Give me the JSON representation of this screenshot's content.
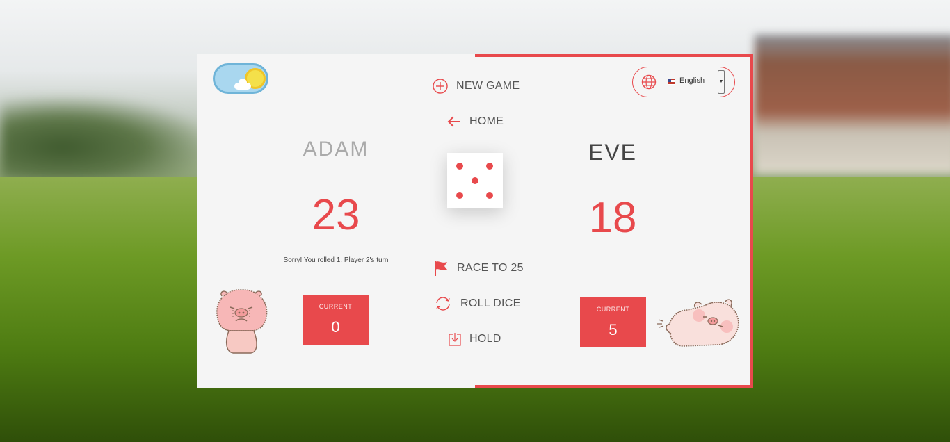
{
  "colors": {
    "accent": "#e8494c",
    "panel": "#f5f5f5"
  },
  "controls": {
    "new_game": "NEW GAME",
    "home": "HOME",
    "race_to": "RACE TO 25",
    "roll_dice": "ROLL DICE",
    "hold": "HOLD"
  },
  "language": {
    "selected": "English",
    "icon": "globe-icon"
  },
  "theme_toggle": {
    "mode": "day",
    "icon": "sun-cloud-icon"
  },
  "dice": {
    "value": 5
  },
  "players": [
    {
      "name": "ADAM",
      "score": "23",
      "current_label": "CURRENT",
      "current": "0",
      "active": false
    },
    {
      "name": "EVE",
      "score": "18",
      "current_label": "CURRENT",
      "current": "5",
      "active": true
    }
  ],
  "message": "Sorry!  You rolled 1. Player 2's turn"
}
